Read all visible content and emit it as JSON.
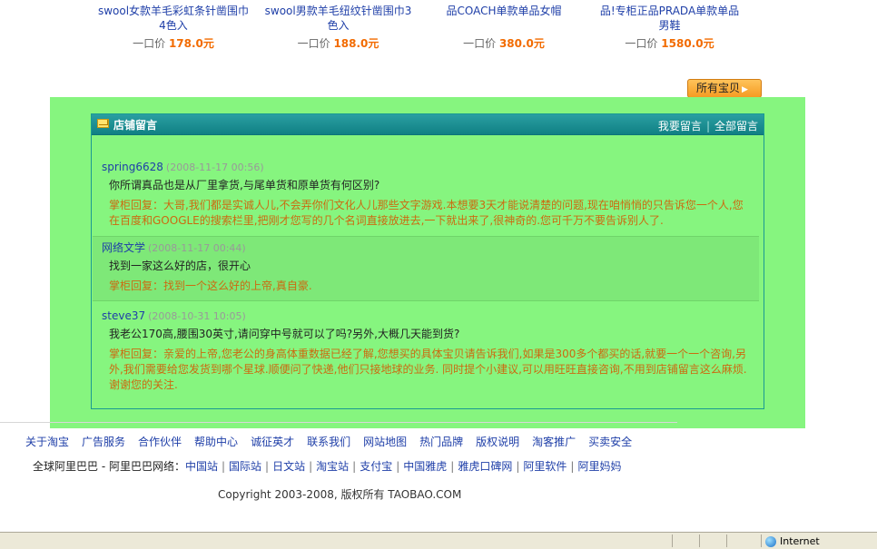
{
  "products": [
    {
      "title": "swool女款羊毛彩虹条针凿围巾4色入",
      "price_label": "一口价",
      "price": "178.0元"
    },
    {
      "title": "swool男款羊毛纽纹针凿围巾3色入",
      "price_label": "一口价",
      "price": "188.0元"
    },
    {
      "title": "品COACH单款单品女帽",
      "price_label": "一口价",
      "price": "380.0元"
    },
    {
      "title": "品!专柜正品PRADA单款单品男鞋",
      "price_label": "一口价",
      "price": "1580.0元"
    }
  ],
  "all_items_button": "所有宝贝",
  "guestbook": {
    "title": "店铺留言",
    "write_link": "我要留言",
    "all_link": "全部留言",
    "messages": [
      {
        "user": "spring6628",
        "time": "(2008-11-17 00:56)",
        "question": "你所谓真品也是从厂里拿货,与尾单货和原单货有何区别?",
        "reply": "掌柜回复：大哥,我们都是实诚人儿,不会弄你们文化人儿那些文字游戏.本想要3天才能说清楚的问题,现在咱悄悄的只告诉您一个人,您在百度和GOOGLE的搜索栏里,把刚才您写的几个名词直接放进去,一下就出来了,很神奇的.您可千万不要告诉别人了."
      },
      {
        "user": "网络文学",
        "time": "(2008-11-17 00:44)",
        "question": "找到一家这么好的店，很开心",
        "reply": "掌柜回复：找到一个这么好的上帝,真自豪."
      },
      {
        "user": "steve37",
        "time": "(2008-10-31 10:05)",
        "question": "我老公170高,腰围30英寸,请问穿中号就可以了吗?另外,大概几天能到货?",
        "reply": "掌柜回复：亲爱的上帝,您老公的身高体重数据已经了解,您想买的具体宝贝请告诉我们,如果是300多个都买的话,就要一个一个咨询,另外,我们需要给您发货到哪个星球.顺便问了快递,他们只接地球的业务. 同时提个小建议,可以用旺旺直接咨询,不用到店铺留言这么麻烦.谢谢您的关注."
      }
    ]
  },
  "footer": {
    "nav": [
      "关于淘宝",
      "广告服务",
      "合作伙伴",
      "帮助中心",
      "诚征英才",
      "联系我们",
      "网站地图",
      "热门品牌",
      "版权说明",
      "淘客推广",
      "买卖安全"
    ],
    "network_label": "全球阿里巴巴 - 阿里巴巴网络：",
    "network": [
      "中国站",
      "国际站",
      "日文站",
      "淘宝站",
      "支付宝",
      "中国雅虎",
      "雅虎口碑网",
      "阿里软件",
      "阿里妈妈"
    ],
    "copyright": "Copyright 2003-2008, 版权所有 TAOBAO.COM"
  },
  "status_bar": {
    "zone": "Internet"
  },
  "colors": {
    "highlight": "#86f57f",
    "link": "#1f3fa8",
    "price": "#f26b00",
    "reply": "#cc6a10",
    "header": "#108084"
  }
}
